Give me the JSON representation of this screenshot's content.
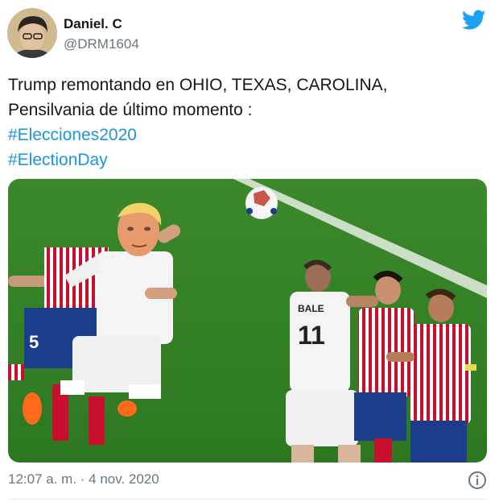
{
  "author": {
    "name": "Daniel. C",
    "handle": "@DRM1604"
  },
  "tweet": {
    "text_line1": "Trump remontando en OHIO, TEXAS, CAROLINA,",
    "text_line2": "Pensilvania de último momento :",
    "hashtags": [
      "#Elecciones2020",
      "#ElectionDay"
    ]
  },
  "media": {
    "jersey_number_left": "5",
    "jersey_text_right": "BALE",
    "jersey_number_right": "11"
  },
  "footer": {
    "timestamp": "12:07 a. m. · 4 nov. 2020"
  },
  "icons": {
    "brand": "twitter-bird-icon",
    "info": "info-icon"
  },
  "colors": {
    "hashtag": "#1b95e0",
    "brand": "#1da1f2",
    "muted": "#657786"
  }
}
